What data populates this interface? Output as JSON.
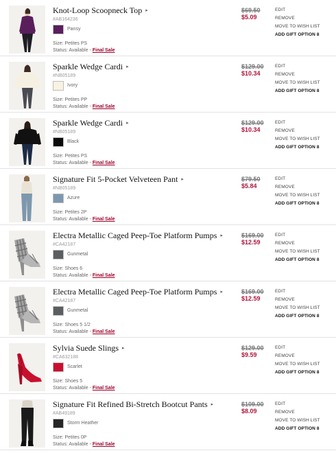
{
  "actions": {
    "edit": "EDIT",
    "remove": "REMOVE",
    "move_to_wish_list": "MOVE TO WISH LIST",
    "add_gift_option": "ADD GIFT OPTION 8"
  },
  "items": [
    {
      "name": "Knot-Loop Scoopneck Top",
      "sku": "#AB164236",
      "color": "Pansy",
      "color_hex": "#5a1e5c",
      "size": "Size: Petites PS",
      "status_text": "Status: Available -",
      "final_sale": "Final Sale",
      "price_old": "$69.50",
      "price_new": "$5.09",
      "image_icon": "purple-top-model-photo"
    },
    {
      "name": "Sparkle Wedge Cardi",
      "sku": "#NB05189",
      "color": "Ivory",
      "color_hex": "#f8f2e0",
      "size": "Size: Petites PP",
      "status_text": "Status: Available -",
      "final_sale": "Final Sale",
      "price_old": "$129.00",
      "price_new": "$10.34",
      "image_icon": "ivory-cardigan-model-photo"
    },
    {
      "name": "Sparkle Wedge Cardi",
      "sku": "#NB05189",
      "color": "Black",
      "color_hex": "#0c0c0c",
      "size": "Size: Petites PS",
      "status_text": "Status: Available -",
      "final_sale": "Final Sale",
      "price_old": "$129.00",
      "price_new": "$10.34",
      "image_icon": "black-cardigan-model-photo"
    },
    {
      "name": "Signature Fit 5-Pocket Velveteen Pant",
      "sku": "#NB05189",
      "color": "Azure",
      "color_hex": "#7d98ae",
      "size": "Size: Petites 2P",
      "status_text": "Status: Available -",
      "final_sale": "Final Sale",
      "price_old": "$79.50",
      "price_new": "$5.84",
      "image_icon": "azure-pants-model-photo"
    },
    {
      "name": "Electra Metallic Caged Peep-Toe Platform Pumps",
      "sku": "#CA42187",
      "color": "Gunmetal",
      "color_hex": "#5b5e60",
      "size": "Size: Shoes 6",
      "status_text": "Status: Available -",
      "final_sale": "Final Sale",
      "price_old": "$169.00",
      "price_new": "$12.59",
      "image_icon": "metallic-pump-photo"
    },
    {
      "name": "Electra Metallic Caged Peep-Toe Platform Pumps",
      "sku": "#CA42187",
      "color": "Gunmetal",
      "color_hex": "#5b5e60",
      "size": "Size: Shoes 5 1/2",
      "status_text": "Status: Available -",
      "final_sale": "Final Sale",
      "price_old": "$169.00",
      "price_new": "$12.59",
      "image_icon": "metallic-pump-photo"
    },
    {
      "name": "Sylvia Suede Slings",
      "sku": "#CA632188",
      "color": "Scarlet",
      "color_hex": "#c8102e",
      "size": "Size: Shoes 5",
      "status_text": "Status: Available -",
      "final_sale": "Final Sale",
      "price_old": "$129.00",
      "price_new": "$9.59",
      "image_icon": "red-slingback-photo"
    },
    {
      "name": "Signature Fit Refined Bi-Stretch Bootcut Pants",
      "sku": "#AB49189",
      "color": "Storm Heather",
      "color_hex": "#262626",
      "size": "Size: Petites 0P",
      "status_text": "Status: Available -",
      "final_sale": "Final Sale",
      "price_old": "$109.00",
      "price_new": "$8.09",
      "image_icon": "black-pants-model-photo"
    }
  ]
}
